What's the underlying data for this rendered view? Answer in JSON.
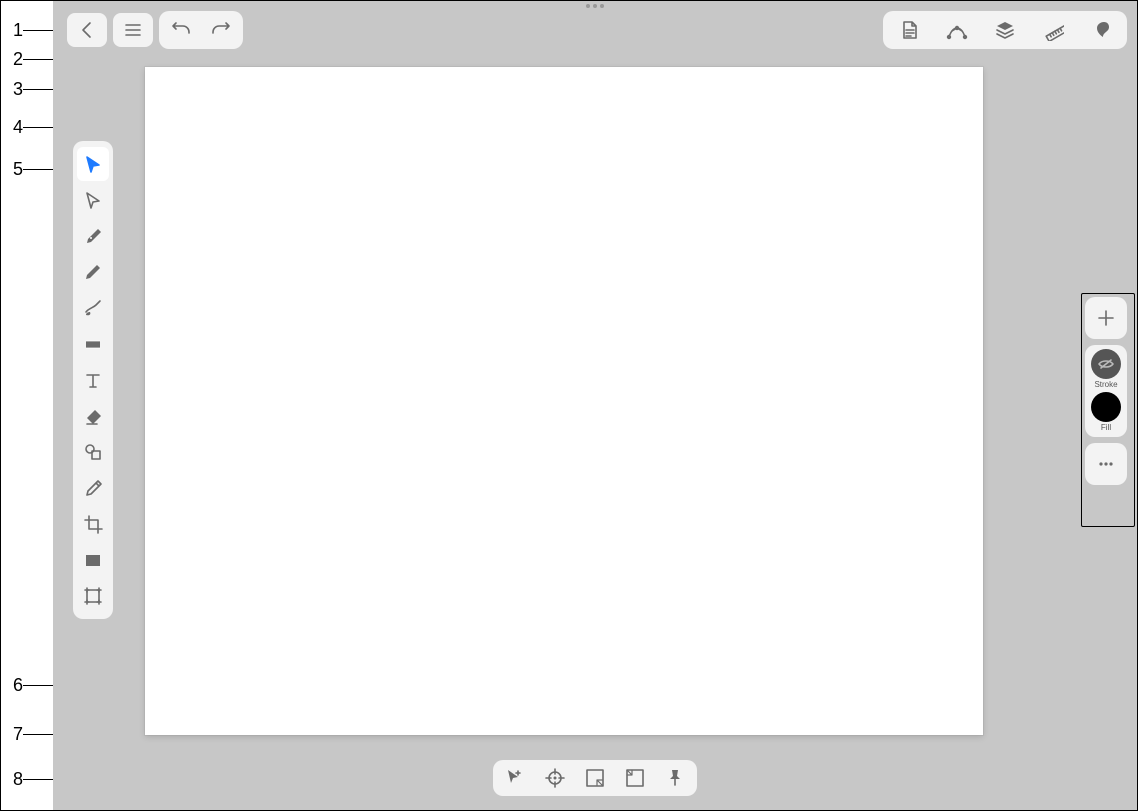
{
  "callouts": [
    "1",
    "2",
    "3",
    "4",
    "5",
    "6",
    "7",
    "8"
  ],
  "top_left": {
    "back": "back",
    "menu": "menu",
    "undo": "undo",
    "redo": "redo"
  },
  "top_right": {
    "items": [
      "document",
      "path",
      "layers",
      "ruler",
      "brush"
    ]
  },
  "tools": {
    "items": [
      {
        "name": "select-arrow",
        "active": true
      },
      {
        "name": "direct-select",
        "active": false
      },
      {
        "name": "pen",
        "active": false
      },
      {
        "name": "pencil",
        "active": false
      },
      {
        "name": "brush",
        "active": false
      },
      {
        "name": "shape",
        "active": false
      },
      {
        "name": "text",
        "active": false
      },
      {
        "name": "eraser",
        "active": false
      },
      {
        "name": "transform",
        "active": false
      },
      {
        "name": "eyedropper",
        "active": false
      },
      {
        "name": "crop",
        "active": false
      },
      {
        "name": "rectangle",
        "active": false
      },
      {
        "name": "artboard",
        "active": false
      }
    ]
  },
  "style_panel": {
    "add": "add",
    "stroke_label": "Stroke",
    "fill_label": "Fill",
    "stroke_color": "#555555",
    "fill_color": "#000000",
    "more": "more"
  },
  "bottom_bar": {
    "items": [
      "edit-select",
      "precision",
      "fit-screen",
      "actual-size",
      "pin"
    ]
  }
}
